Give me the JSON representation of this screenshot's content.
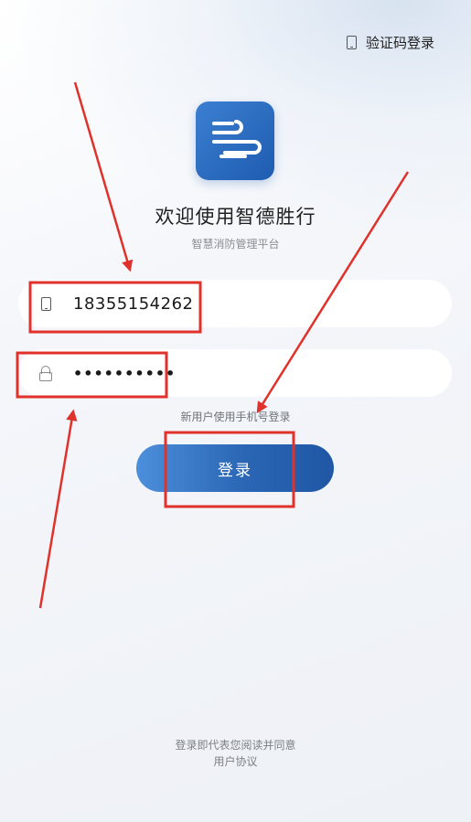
{
  "header": {
    "sms_login_label": "验证码登录",
    "sms_login_icon": "phone-icon"
  },
  "brand": {
    "logo_icon": "wind-lines-icon",
    "title": "欢迎使用智德胜行",
    "subtitle": "智慧消防管理平台",
    "accent_color": "#2a66b5"
  },
  "form": {
    "phone": {
      "icon": "phone-icon",
      "value": "18355154262"
    },
    "password": {
      "icon": "lock-icon",
      "masked_value": "••••••••••"
    },
    "new_user_hint": "新用户使用手机号登录",
    "login_button_label": "登录"
  },
  "footer": {
    "agreement_text": "登录即代表您阅读并同意",
    "agreement_link": "用户协议"
  },
  "annotation": {
    "color": "#e0312b",
    "shapes": [
      "highlight-box",
      "arrow"
    ]
  }
}
